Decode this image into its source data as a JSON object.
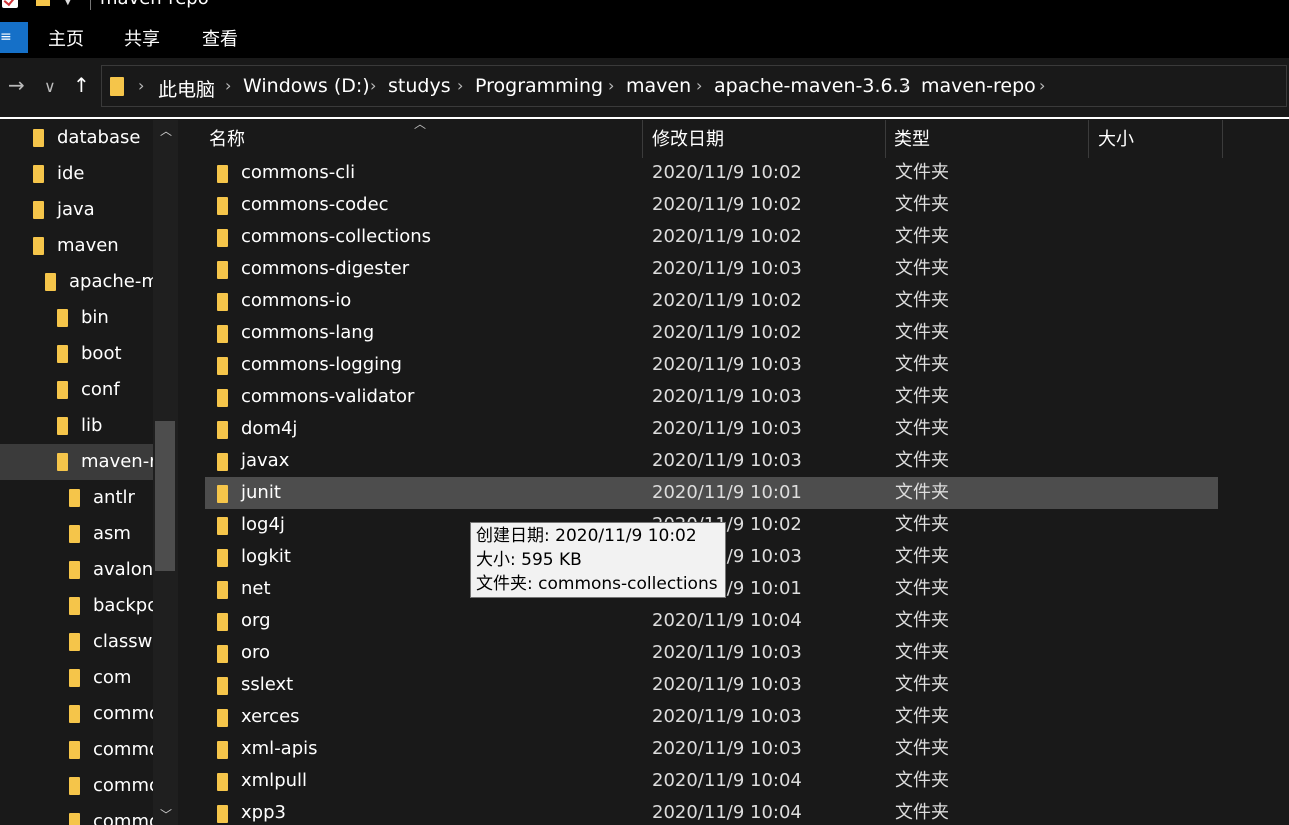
{
  "window": {
    "title": "maven-repo"
  },
  "ribbon": {
    "file_label": "≡",
    "tabs": [
      "主页",
      "共享",
      "查看"
    ]
  },
  "nav": {
    "back_icon": "arrow-left-icon",
    "forward_icon": "arrow-right-icon",
    "up_icon": "arrow-up-icon",
    "breadcrumbs": [
      "此电脑",
      "Windows (D:)",
      "studys",
      "Programming",
      "maven",
      "apache-maven-3.6.3",
      "maven-repo"
    ]
  },
  "tree": [
    {
      "label": "database"
    },
    {
      "label": "ide"
    },
    {
      "label": "java"
    },
    {
      "label": "maven"
    },
    {
      "label": "apache-m"
    },
    {
      "label": "bin"
    },
    {
      "label": "boot"
    },
    {
      "label": "conf"
    },
    {
      "label": "lib"
    },
    {
      "label": "maven-r",
      "selected": true
    },
    {
      "label": "antlr"
    },
    {
      "label": "asm"
    },
    {
      "label": "avalon-"
    },
    {
      "label": "backpo"
    },
    {
      "label": "classwo"
    },
    {
      "label": "com"
    },
    {
      "label": "commo"
    },
    {
      "label": "commo"
    },
    {
      "label": "commo"
    },
    {
      "label": "commo"
    }
  ],
  "columns": {
    "name": "名称",
    "modified": "修改日期",
    "type": "类型",
    "size": "大小"
  },
  "files": [
    {
      "name": "commons-cli",
      "modified": "2020/11/9 10:02",
      "type": "文件夹"
    },
    {
      "name": "commons-codec",
      "modified": "2020/11/9 10:02",
      "type": "文件夹"
    },
    {
      "name": "commons-collections",
      "modified": "2020/11/9 10:02",
      "type": "文件夹"
    },
    {
      "name": "commons-digester",
      "modified": "2020/11/9 10:03",
      "type": "文件夹"
    },
    {
      "name": "commons-io",
      "modified": "2020/11/9 10:02",
      "type": "文件夹"
    },
    {
      "name": "commons-lang",
      "modified": "2020/11/9 10:02",
      "type": "文件夹"
    },
    {
      "name": "commons-logging",
      "modified": "2020/11/9 10:03",
      "type": "文件夹"
    },
    {
      "name": "commons-validator",
      "modified": "2020/11/9 10:03",
      "type": "文件夹"
    },
    {
      "name": "dom4j",
      "modified": "2020/11/9 10:03",
      "type": "文件夹"
    },
    {
      "name": "javax",
      "modified": "2020/11/9 10:03",
      "type": "文件夹"
    },
    {
      "name": "junit",
      "modified": "2020/11/9 10:01",
      "type": "文件夹",
      "highlighted": true
    },
    {
      "name": "log4j",
      "modified": "2020/11/9 10:02",
      "type": "文件夹"
    },
    {
      "name": "logkit",
      "modified": "2020/11/9 10:03",
      "type": "文件夹"
    },
    {
      "name": "net",
      "modified": "2020/11/9 10:01",
      "type": "文件夹"
    },
    {
      "name": "org",
      "modified": "2020/11/9 10:04",
      "type": "文件夹"
    },
    {
      "name": "oro",
      "modified": "2020/11/9 10:03",
      "type": "文件夹"
    },
    {
      "name": "sslext",
      "modified": "2020/11/9 10:03",
      "type": "文件夹"
    },
    {
      "name": "xerces",
      "modified": "2020/11/9 10:03",
      "type": "文件夹"
    },
    {
      "name": "xml-apis",
      "modified": "2020/11/9 10:03",
      "type": "文件夹"
    },
    {
      "name": "xmlpull",
      "modified": "2020/11/9 10:04",
      "type": "文件夹"
    },
    {
      "name": "xpp3",
      "modified": "2020/11/9 10:04",
      "type": "文件夹"
    }
  ],
  "tooltip": {
    "created": "创建日期: 2020/11/9 10:02",
    "size": "大小: 595 KB",
    "contents": "文件夹: commons-collections"
  }
}
